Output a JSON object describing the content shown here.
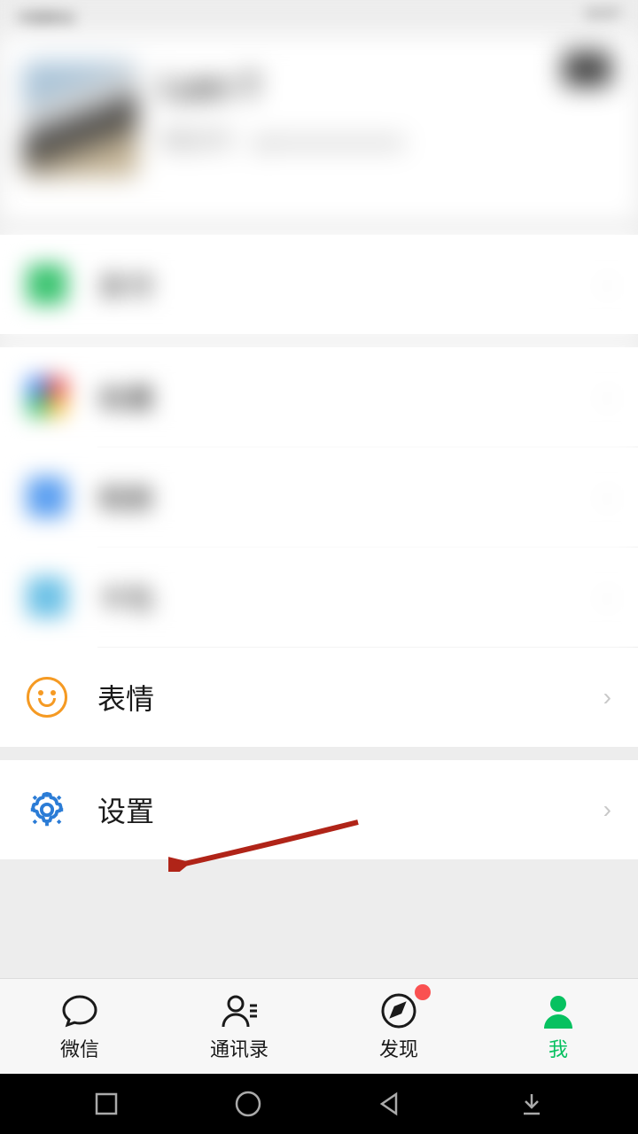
{
  "statusBar": {
    "left": "中国移动",
    "right": "10:07"
  },
  "profile": {
    "nickname": "Lam T",
    "wxid": "微信号：qxxxxxxxxxxxx"
  },
  "menu": {
    "wallet": "支付",
    "favorites": "收藏",
    "album": "相册",
    "cards": "卡包",
    "sticker": "表情",
    "settings": "设置"
  },
  "tabs": {
    "chat": "微信",
    "contacts": "通讯录",
    "discover": "发现",
    "me": "我"
  },
  "colors": {
    "accent": "#07c160",
    "arrow": "#c0392b"
  }
}
